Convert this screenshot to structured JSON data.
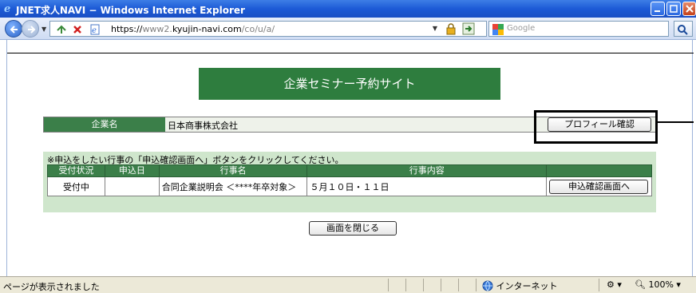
{
  "window": {
    "title": "JNET求人NAVI − Windows Internet Explorer"
  },
  "address_bar": {
    "url_prefix": "https://",
    "url_sub": "www2.",
    "url_domain": "kyujin-navi.com",
    "url_path": "/co/u/a/",
    "search_placeholder": "Google"
  },
  "page": {
    "banner": "企業セミナー予約サイト",
    "company": {
      "label": "企業名",
      "value": "日本商事株式会社",
      "profile_button": "プロフィール確認"
    },
    "events": {
      "note": "※申込をしたい行事の「申込確認画面へ」ボタンをクリックしてください。",
      "headers": [
        "受付状況",
        "申込日",
        "行事名",
        "行事内容",
        ""
      ],
      "rows": [
        {
          "status": "受付中",
          "date": "",
          "name": "合同企業説明会 ＜****年卒対象＞",
          "content": "５月１０日・１１日",
          "action": "申込確認画面へ"
        }
      ]
    },
    "close_button": "画面を閉じる"
  },
  "status_bar": {
    "text": "ページが表示されました",
    "zone": "インターネット",
    "zoom": "100%"
  },
  "colors": {
    "banner_bg": "#2e7d3e",
    "header_bg": "#3b7f49",
    "section_bg": "#cfe6cc",
    "titlebar": "#1c5ad6"
  }
}
